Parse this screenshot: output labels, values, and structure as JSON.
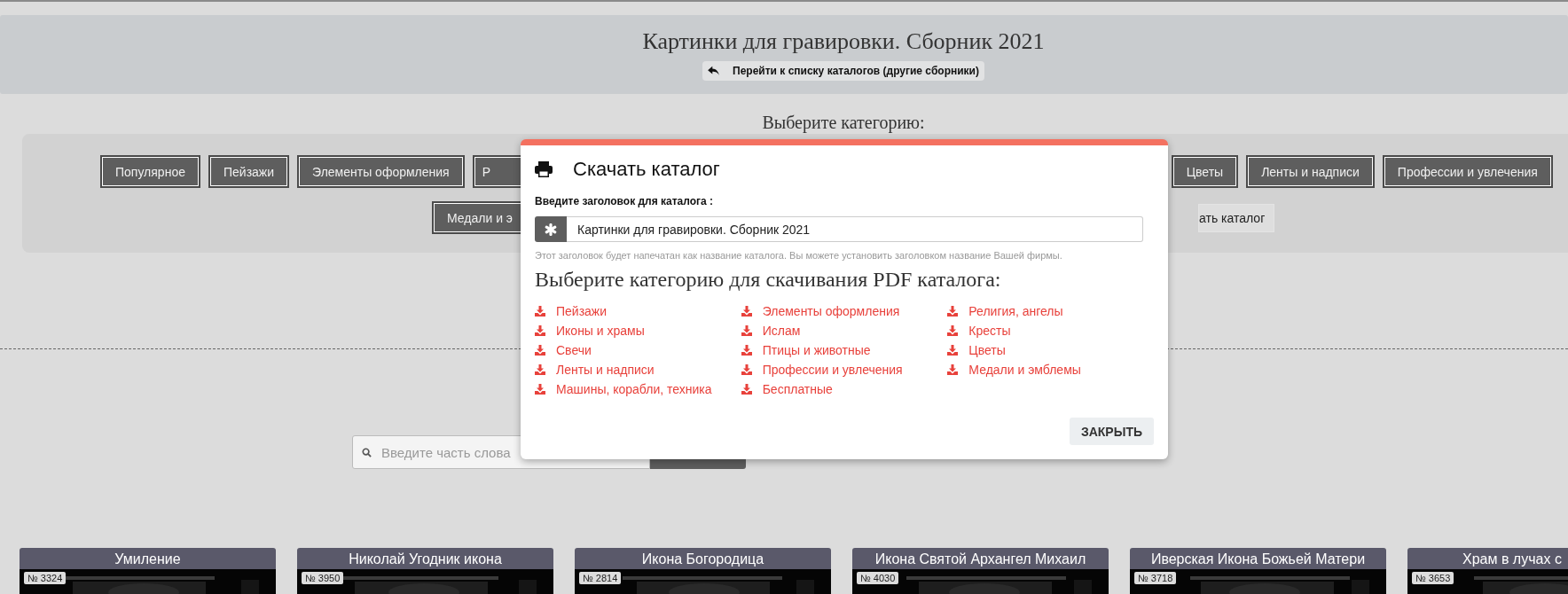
{
  "header": {
    "title": "Картинки для гравировки. Сборник 2021",
    "back_link": "Перейти к списку каталогов (другие сборники)"
  },
  "categories": {
    "heading": "Выберите категорию:",
    "rows": [
      {
        "left": [
          {
            "label": "Популярное",
            "kind": "category"
          },
          {
            "label": "Пейзажи",
            "kind": "category"
          },
          {
            "label": "Элементы оформления",
            "kind": "category"
          },
          {
            "label": "Р",
            "kind": "category"
          }
        ],
        "right": [
          {
            "label": "Цветы",
            "kind": "category"
          },
          {
            "label": "Ленты и надписи",
            "kind": "category"
          },
          {
            "label": "Профессии и увлечения",
            "kind": "category"
          }
        ]
      },
      {
        "left": [
          {
            "label": "Медали и э",
            "kind": "category"
          }
        ],
        "right": [
          {
            "label": "ать каталог",
            "kind": "download"
          }
        ]
      }
    ]
  },
  "search": {
    "placeholder": "Введите часть слова"
  },
  "cards": [
    {
      "title": "Умиление",
      "number": "№ 3324"
    },
    {
      "title": "Николай Угодник икона",
      "number": "№ 3950"
    },
    {
      "title": "Икона Богородица",
      "number": "№ 2814"
    },
    {
      "title": "Икона Святой Архангел Михаил",
      "number": "№ 4030"
    },
    {
      "title": "Иверская Икона Божьей Матери",
      "number": "№ 3718"
    },
    {
      "title": "Храм в лучах с",
      "number": "№ 3653"
    }
  ],
  "modal": {
    "title": "Скачать каталог",
    "field_label": "Введите заголовок для каталога :",
    "field_value": "Картинки для гравировки. Сборник 2021",
    "hint": "Этот заголовок будет напечатан как название каталога. Вы можете установить заголовком название Вашей фирмы.",
    "heading": "Выберите категорию для скачивания PDF каталога:",
    "columns": [
      [
        "Пейзажи",
        "Иконы и храмы",
        "Свечи",
        "Ленты и надписи",
        "Машины, корабли, техника"
      ],
      [
        "Элементы оформления",
        "Ислам",
        "Птицы и животные",
        "Профессии и увлечения",
        "Бесплатные"
      ],
      [
        "Религия, ангелы",
        "Кресты",
        "Цветы",
        "Медали и эмблемы"
      ]
    ],
    "close": "ЗАКРЫТЬ"
  }
}
